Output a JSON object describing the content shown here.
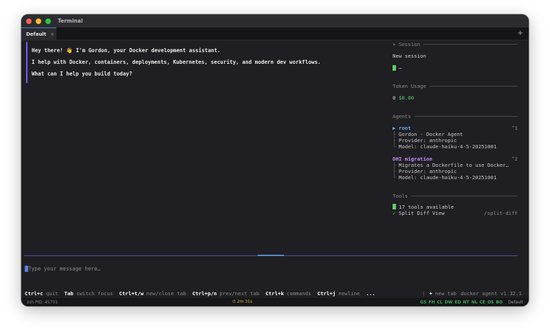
{
  "window": {
    "title": "Terminal"
  },
  "tabs": [
    {
      "label": "Default",
      "close": "×"
    }
  ],
  "new_tab_glyph": "+",
  "chat": {
    "messages": [
      "Hey there! 👋 I'm Gordon, your Docker development assistant.",
      "I help with Docker, containers, deployments, Kubernetes, security, and modern dev workflows.",
      "What can I help you build today?"
    ]
  },
  "sidebar": {
    "session": {
      "title": "» Session",
      "name": "New session",
      "path": "~"
    },
    "token_usage": {
      "title": "Token Usage",
      "count": "0",
      "cost": "$0.00"
    },
    "agents": {
      "title": "Agents",
      "items": [
        {
          "name": "▶ root",
          "shortcut": "^1",
          "description": "Gordon - Docker Agent",
          "provider": "Provider: anthropic",
          "model": "Model: claude-haiku-4-5-20251001"
        },
        {
          "name": "DHI migration",
          "shortcut": "^2",
          "description": "Migrates a Dockerfile to use Docker…",
          "provider": "Provider: anthropic",
          "model": "Model: claude-haiku-4-5-20251001"
        }
      ]
    },
    "tools": {
      "title": "Tools",
      "available": "17 tools available",
      "split_diff_check": "✓",
      "split_diff": "Split Diff View",
      "split_diff_cmd": "/split-diff"
    }
  },
  "input": {
    "placeholder": "Type your message here…"
  },
  "help": {
    "items": [
      {
        "key": "Ctrl+c",
        "desc": "quit"
      },
      {
        "key": "Tab",
        "desc": "switch focus"
      },
      {
        "key": "Ctrl+t/w",
        "desc": "new/close tab"
      },
      {
        "key": "Ctrl+p/n",
        "desc": "prev/next tab"
      },
      {
        "key": "Ctrl+k",
        "desc": "commands"
      },
      {
        "key": "Ctrl+j",
        "desc": "newline"
      }
    ],
    "more": "...",
    "separator": "|",
    "new_tab_key": "+",
    "new_tab_desc": "new tab",
    "version": "docker agent v1.32.1"
  },
  "status_bar": {
    "left": "zsh   PID: 45701",
    "timer": "⏱ 2m 31s",
    "modes": [
      "GS",
      "FH",
      "CL",
      "DW",
      "ED",
      "NT",
      "NL",
      "CE",
      "OS",
      "BO"
    ],
    "profile": "Default"
  },
  "colors": {
    "background": "#1f1f23",
    "accent_purple": "#7a5af8",
    "accent_blue": "#6fa8ff",
    "agent_purple": "#c48cff",
    "success_green": "#5fd068",
    "timer_yellow": "#e8b840"
  }
}
